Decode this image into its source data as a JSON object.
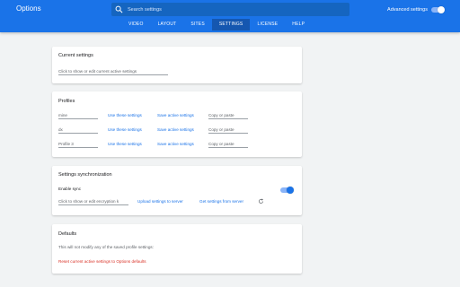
{
  "app": {
    "title": "Options"
  },
  "search": {
    "placeholder": "Search settings"
  },
  "advanced": {
    "label": "Advanced settings",
    "enabled": true
  },
  "tabs": [
    {
      "label": "VIDEO",
      "active": false
    },
    {
      "label": "LAYOUT",
      "active": false
    },
    {
      "label": "SITES",
      "active": false
    },
    {
      "label": "SETTINGS",
      "active": true
    },
    {
      "label": "LICENSE",
      "active": false
    },
    {
      "label": "HELP",
      "active": false
    }
  ],
  "current_settings": {
    "title": "Current settings",
    "field": "Click to show or edit current active settings"
  },
  "profiles": {
    "title": "Profiles",
    "rows": [
      {
        "name": "mine",
        "use": "Use these settings",
        "save": "Save active settings",
        "copy": "Copy or paste"
      },
      {
        "name": "dx",
        "use": "Use these settings",
        "save": "Save active settings",
        "copy": "Copy or paste"
      },
      {
        "name": "Profile 3",
        "use": "Use these settings",
        "save": "Save active settings",
        "copy": "Copy or paste"
      }
    ]
  },
  "sync": {
    "title": "Settings synchronization",
    "enable_label": "Enable sync",
    "enabled": true,
    "key_field": "Click to show or edit encryption k",
    "upload": "Upload settings to server",
    "download": "Get settings from server",
    "refresh_icon": "refresh-icon"
  },
  "defaults": {
    "title": "Defaults",
    "note": "This will not modify any of the saved profile settings:",
    "reset": "Reset current active settings to Options defaults"
  },
  "colors": {
    "header": "#1a73e8",
    "link": "#1a73e8",
    "danger": "#d93025"
  }
}
